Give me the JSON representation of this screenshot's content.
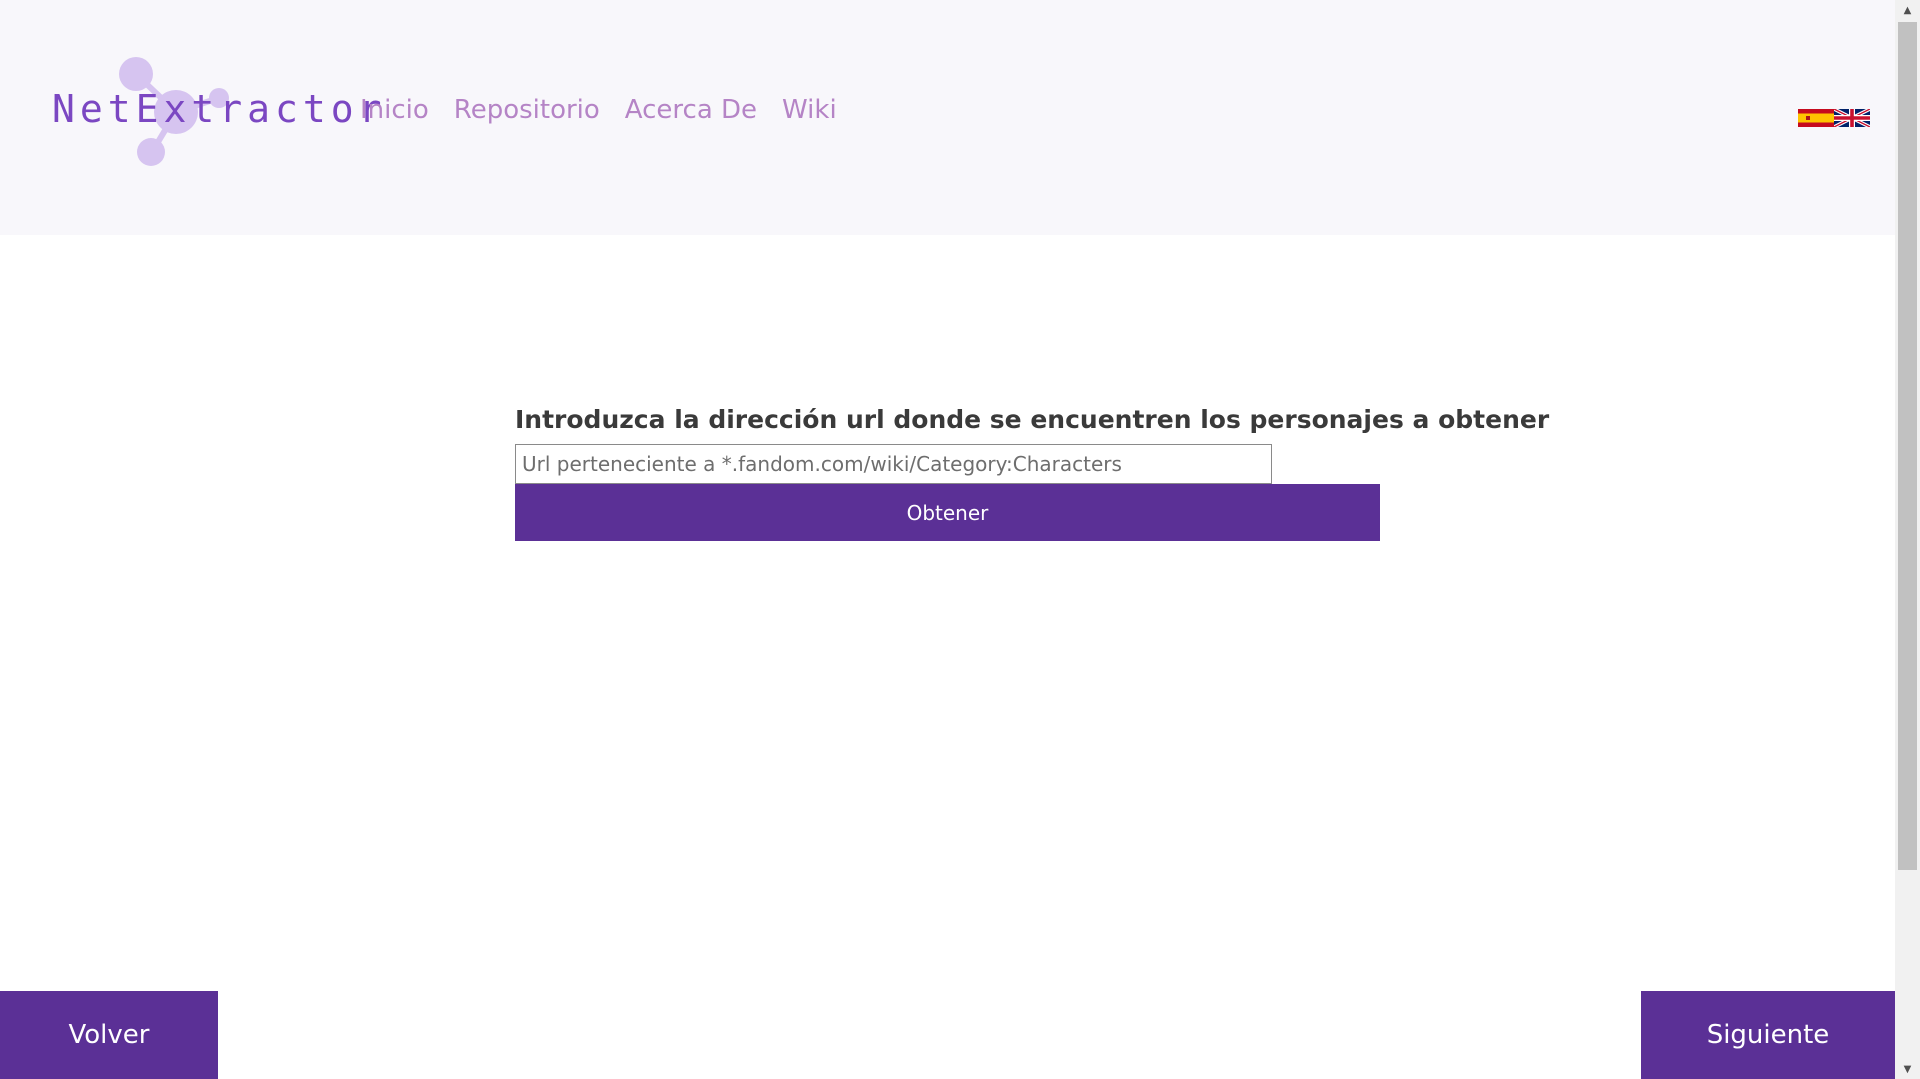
{
  "header": {
    "logo_text": "NetExtractor",
    "nav": [
      {
        "label": "Inicio"
      },
      {
        "label": "Repositorio"
      },
      {
        "label": "Acerca De"
      },
      {
        "label": "Wiki"
      }
    ],
    "languages": [
      "spain-flag-icon",
      "uk-flag-icon"
    ]
  },
  "main": {
    "prompt": "Introduzca la dirección url donde se encuentren los personajes a obtener",
    "url_input": {
      "value": "",
      "placeholder": "Url perteneciente a *.fandom.com/wiki/Category:Characters"
    },
    "obtain_label": "Obtener"
  },
  "footer": {
    "back_label": "Volver",
    "next_label": "Siguiente"
  },
  "colors": {
    "accent": "#5b3096",
    "nav_link": "#b584c6",
    "logo": "#7b47c2",
    "logo_nodes": "#d6c4f0",
    "header_bg": "#f8f7fb"
  }
}
